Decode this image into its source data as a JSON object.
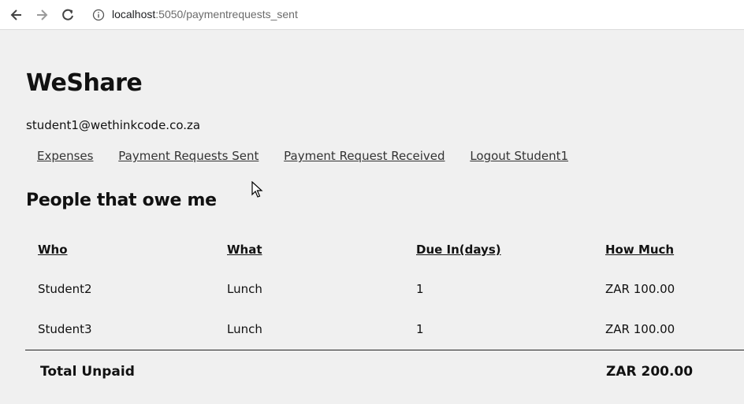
{
  "browser": {
    "url_host": "localhost",
    "url_path": ":5050/paymentrequests_sent"
  },
  "app": {
    "title": "WeShare",
    "user_email": "student1@wethinkcode.co.za"
  },
  "nav": {
    "links": [
      "Expenses",
      "Payment Requests Sent",
      "Payment Request Received",
      "Logout Student1"
    ]
  },
  "section": {
    "title": "People that owe me"
  },
  "table": {
    "headers": [
      "Who",
      "What",
      "Due In(days)",
      "How Much"
    ],
    "rows": [
      [
        "Student2",
        "Lunch",
        "1",
        "ZAR 100.00"
      ],
      [
        "Student3",
        "Lunch",
        "1",
        "ZAR 100.00"
      ]
    ],
    "total_label": "Total Unpaid",
    "total_value": "ZAR 200.00"
  }
}
